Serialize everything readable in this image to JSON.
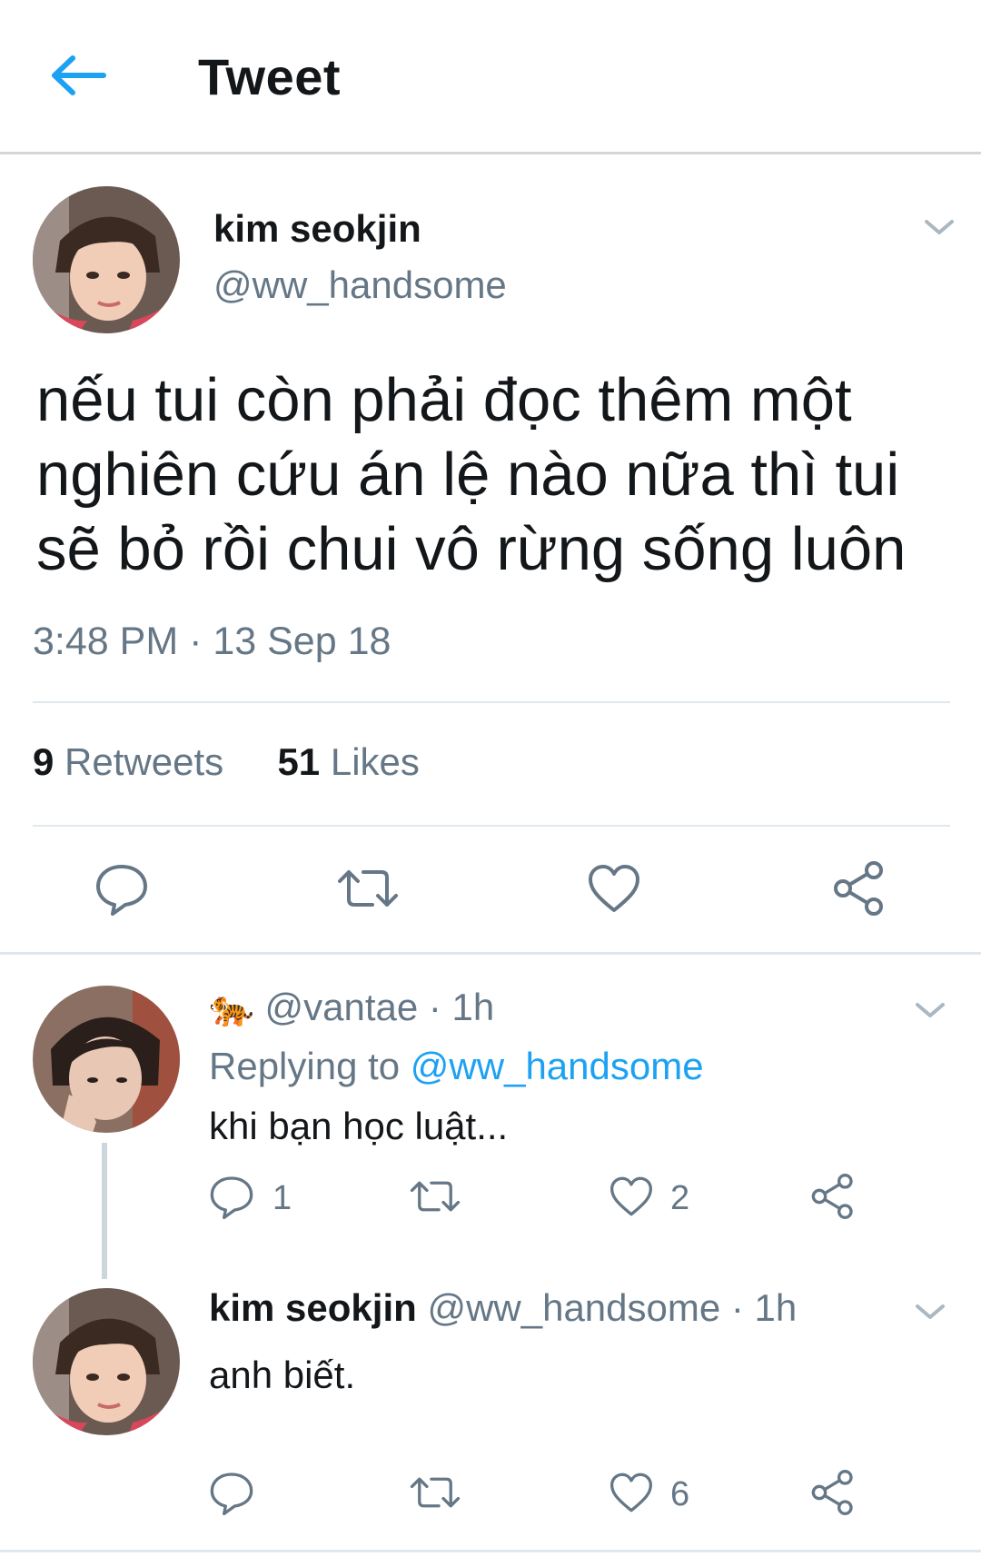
{
  "header": {
    "title": "Tweet"
  },
  "main_tweet": {
    "name": "kim seokjin",
    "handle": "@ww_handsome",
    "text": "nếu tui còn phải đọc thêm một nghiên cứu án lệ nào nữa thì tui sẽ bỏ rồi chui vô rừng sống luôn",
    "timestamp": "3:48 PM · 13 Sep 18",
    "retweets_count": "9",
    "retweets_label": "Retweets",
    "likes_count": "51",
    "likes_label": "Likes"
  },
  "reply1": {
    "emoji": "🐅",
    "handle": "@vantae",
    "time": "· 1h",
    "replying_prefix": "Replying to",
    "replying_handle": "@ww_handsome",
    "text": "khi bạn học luật...",
    "reply_count": "1",
    "like_count": "2"
  },
  "reply2": {
    "name": "kim seokjin",
    "handle": "@ww_handsome",
    "time": "· 1h",
    "text": "anh biết.",
    "like_count": "6"
  },
  "colors": {
    "accent": "#1da1f2",
    "muted": "#657786",
    "text": "#14171a",
    "divider": "#e1e8ed"
  },
  "icons": [
    "back-arrow-icon",
    "chevron-down-icon",
    "reply-icon",
    "retweet-icon",
    "heart-icon",
    "share-icon",
    "tiger-emoji-icon"
  ]
}
